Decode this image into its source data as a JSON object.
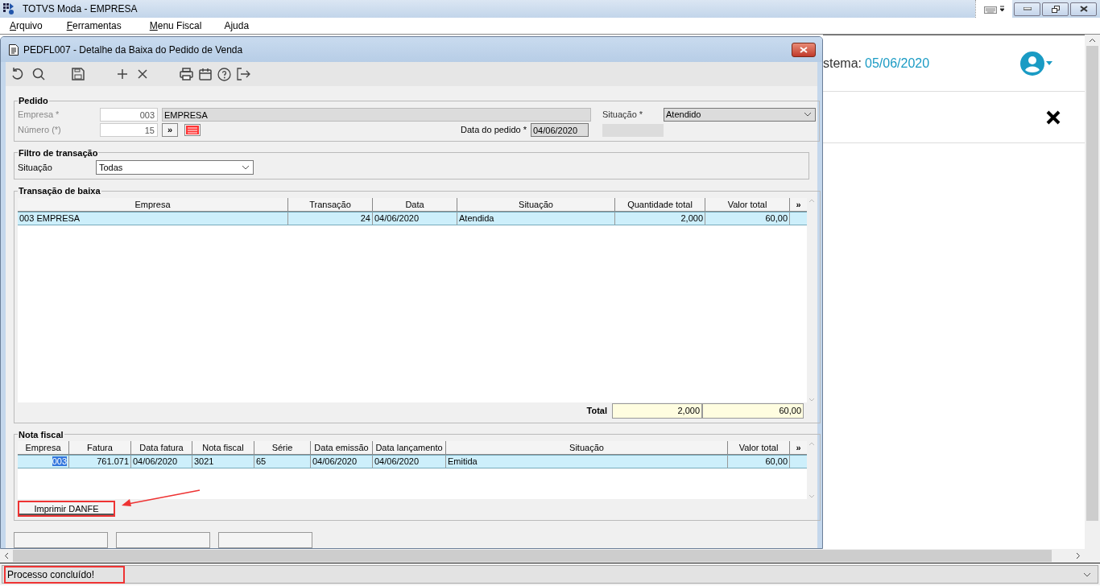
{
  "app": {
    "title": "TOTVS Moda - EMPRESA",
    "menu": [
      {
        "accel": "A",
        "rest": "rquivo"
      },
      {
        "accel": "F",
        "rest": "erramentas"
      },
      {
        "accel": "M",
        "rest": "enu Fiscal"
      },
      {
        "rest": "Ajuda"
      }
    ],
    "system_date_label": "stema:",
    "system_date": "05/06/2020"
  },
  "dialog": {
    "title": "PEDFL007 - Detalhe da Baixa do Pedido de Venda",
    "pedido": {
      "title": "Pedido",
      "empresa_label": "Empresa *",
      "empresa_code": "003",
      "empresa_name": "EMPRESA",
      "numero_label": "Número (*)",
      "numero": "15",
      "next_button": "»",
      "data_label": "Data do pedido *",
      "data": "04/06/2020",
      "situacao_label": "Situação *",
      "situacao": "Atendido"
    },
    "filtro": {
      "title": "Filtro de transação",
      "situacao_label": "Situação",
      "situacao": "Todas"
    },
    "transacoes": {
      "title": "Transação de baixa",
      "columns": [
        {
          "label": "Empresa"
        },
        {
          "label": "Transação"
        },
        {
          "label": "Data"
        },
        {
          "label": "Situação"
        },
        {
          "label": "Quantidade total"
        },
        {
          "label": "Valor total"
        }
      ],
      "more_button": "»",
      "rows": [
        {
          "selected": true,
          "cells": [
            "003 EMPRESA",
            "24",
            "04/06/2020",
            "Atendida",
            "2,000",
            "60,00"
          ]
        }
      ],
      "total_label": "Total",
      "total_quantidade": "2,000",
      "total_valor": "60,00"
    },
    "nota_fiscal": {
      "title": "Nota fiscal",
      "columns": [
        {
          "label": "Empresa"
        },
        {
          "label": "Fatura"
        },
        {
          "label": "Data fatura"
        },
        {
          "label": "Nota fiscal"
        },
        {
          "label": "Série"
        },
        {
          "label": "Data emissão"
        },
        {
          "label": "Data lançamento"
        },
        {
          "label": "Situação"
        },
        {
          "label": "Valor total"
        }
      ],
      "more_button": "»",
      "rows": [
        {
          "selected": true,
          "cells": [
            "003",
            "761.071",
            "04/06/2020",
            "3021",
            "65",
            "04/06/2020",
            "04/06/2020",
            "Emitida",
            "60,00"
          ]
        }
      ],
      "print_button": "Imprimir DANFE"
    }
  },
  "status_bar": {
    "message": "Processo concluído!"
  }
}
